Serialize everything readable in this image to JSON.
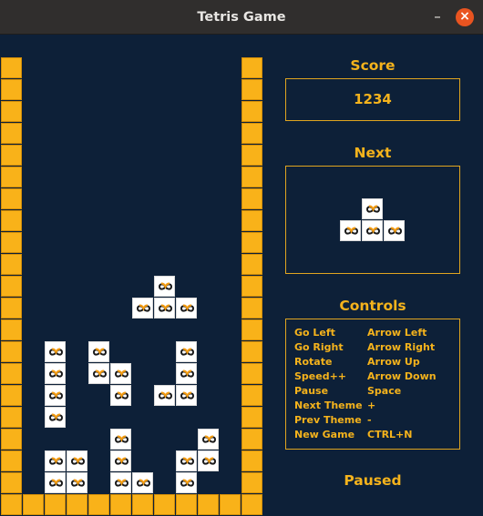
{
  "window": {
    "title": "Tetris Game",
    "minimize_glyph": "–",
    "close_glyph": "×"
  },
  "colors": {
    "background": "#0d2038",
    "wall": "#f9b219",
    "accent_text": "#f5b31c",
    "block": "#ffffff",
    "logo_black": "#1a1a1a",
    "logo_orange": "#f39c12"
  },
  "block_icon": "infinity-logo-icon",
  "board": {
    "columns": 12,
    "rows": 21,
    "wall_columns": [
      0,
      11
    ],
    "floor_row": 20,
    "active_piece": [
      [
        7,
        10
      ],
      [
        6,
        11
      ],
      [
        7,
        11
      ],
      [
        8,
        11
      ]
    ],
    "settled_blocks": [
      [
        2,
        13
      ],
      [
        4,
        13
      ],
      [
        8,
        13
      ],
      [
        2,
        14
      ],
      [
        4,
        14
      ],
      [
        5,
        14
      ],
      [
        8,
        14
      ],
      [
        2,
        15
      ],
      [
        5,
        15
      ],
      [
        7,
        15
      ],
      [
        8,
        15
      ],
      [
        2,
        16
      ],
      [
        5,
        17
      ],
      [
        9,
        17
      ],
      [
        2,
        18
      ],
      [
        3,
        18
      ],
      [
        5,
        18
      ],
      [
        8,
        18
      ],
      [
        9,
        18
      ],
      [
        2,
        19
      ],
      [
        3,
        19
      ],
      [
        5,
        19
      ],
      [
        6,
        19
      ],
      [
        8,
        19
      ]
    ]
  },
  "score": {
    "label": "Score",
    "value": "1234"
  },
  "next": {
    "label": "Next",
    "piece": [
      [
        1,
        0
      ],
      [
        0,
        1
      ],
      [
        1,
        1
      ],
      [
        2,
        1
      ]
    ]
  },
  "controls": {
    "label": "Controls",
    "items": [
      {
        "action": "Go Left",
        "key": "Arrow Left"
      },
      {
        "action": "Go Right",
        "key": "Arrow Right"
      },
      {
        "action": "Rotate",
        "key": "Arrow Up"
      },
      {
        "action": "Speed++",
        "key": "Arrow Down"
      },
      {
        "action": "Pause",
        "key": "Space"
      },
      {
        "action": "Next Theme",
        "key": "+"
      },
      {
        "action": "Prev Theme",
        "key": "-"
      },
      {
        "action": "New Game",
        "key": "CTRL+N"
      }
    ]
  },
  "status": "Paused"
}
